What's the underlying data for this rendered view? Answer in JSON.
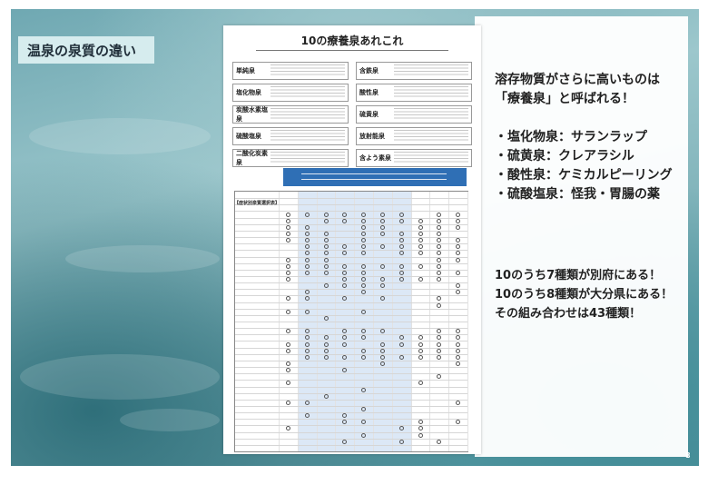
{
  "slide": {
    "title": "温泉の泉質の違い",
    "page_number": "8"
  },
  "document": {
    "title": "10の療養泉あれこれ",
    "springs": [
      {
        "name": "単純泉"
      },
      {
        "name": "含鉄泉"
      },
      {
        "name": "塩化物泉"
      },
      {
        "name": "酸性泉"
      },
      {
        "name": "炭酸水素塩泉"
      },
      {
        "name": "硫黄泉"
      },
      {
        "name": "硫酸塩泉"
      },
      {
        "name": "放射能泉"
      },
      {
        "name": "二酸化炭素泉"
      },
      {
        "name": "含よう素泉"
      }
    ],
    "table_label": "【症状別泉質選択表】"
  },
  "headline": {
    "line1": "溶存物質がさらに高いものは",
    "line2": "「療養泉」と呼ばれる！"
  },
  "bullets": [
    "・塩化物泉：サランラップ",
    "・硫黄泉：クレアラシル",
    "・酸性泉：ケミカルピーリング",
    "・硫酸塩泉：怪我・胃腸の薬"
  ],
  "facts": [
    "10のうち7種類が別府にある！",
    "10のうち8種類が大分県にある！",
    "その組み合わせは43種類！"
  ]
}
